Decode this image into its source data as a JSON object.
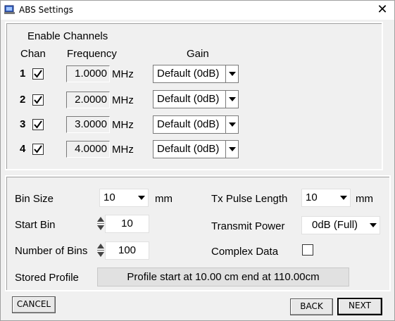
{
  "window": {
    "title": "ABS Settings",
    "close_glyph": "✕"
  },
  "channels": {
    "group_label": "Enable Channels",
    "headers": {
      "chan": "Chan",
      "frequency": "Frequency",
      "gain": "Gain"
    },
    "rows": [
      {
        "num": "1",
        "enabled": true,
        "freq": "1.0000",
        "unit": "MHz",
        "gain": "Default (0dB)"
      },
      {
        "num": "2",
        "enabled": true,
        "freq": "2.0000",
        "unit": "MHz",
        "gain": "Default (0dB)"
      },
      {
        "num": "3",
        "enabled": true,
        "freq": "3.0000",
        "unit": "MHz",
        "gain": "Default (0dB)"
      },
      {
        "num": "4",
        "enabled": true,
        "freq": "4.0000",
        "unit": "MHz",
        "gain": "Default (0dB)"
      }
    ]
  },
  "settings": {
    "bin_size": {
      "label": "Bin Size",
      "value": "10",
      "unit": "mm"
    },
    "start_bin": {
      "label": "Start Bin",
      "value": "10"
    },
    "num_bins": {
      "label": "Number of Bins",
      "value": "100"
    },
    "stored_profile": {
      "label": "Stored Profile",
      "value": "Profile start at 10.00 cm end at 110.00cm"
    },
    "tx_pulse": {
      "label": "Tx Pulse Length",
      "value": "10",
      "unit": "mm"
    },
    "transmit_power": {
      "label": "Transmit Power",
      "value": "0dB (Full)"
    },
    "complex_data": {
      "label": "Complex Data",
      "checked": false
    }
  },
  "buttons": {
    "cancel": "CANCEL",
    "back": "BACK",
    "next": "NEXT"
  }
}
